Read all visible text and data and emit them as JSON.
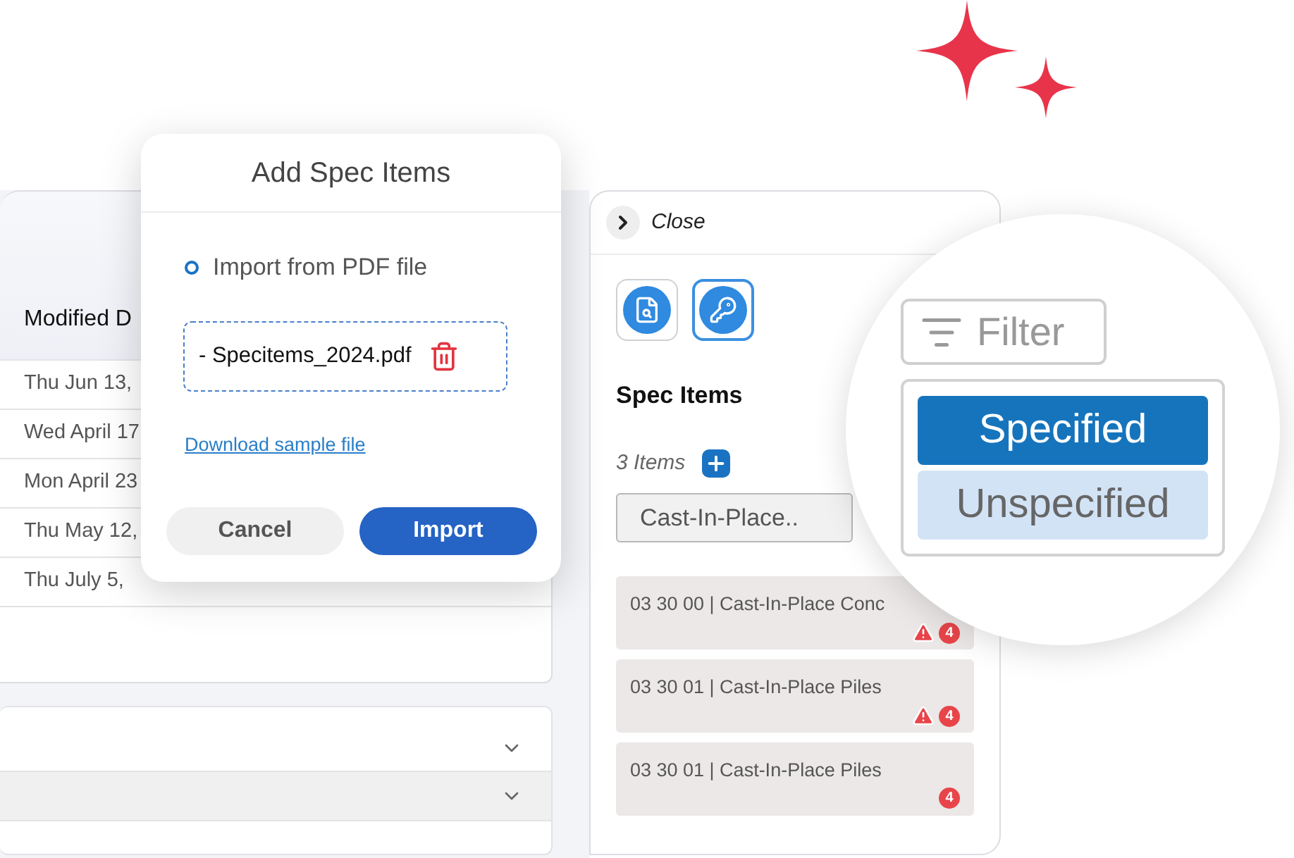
{
  "table": {
    "header": "Modified D",
    "rows": [
      "Thu Jun 13,",
      "Wed April 17",
      "Mon April 23",
      "Thu May 12,",
      "Thu July 5,"
    ]
  },
  "accordion": [
    {
      "expanded": false,
      "highlighted": false
    },
    {
      "expanded": false,
      "highlighted": true
    }
  ],
  "modal": {
    "title": "Add Spec Items",
    "option": {
      "label": "Import from PDF file",
      "selected": true
    },
    "file": "- Specitems_2024.pdf",
    "link": "Download sample file",
    "buttons": [
      {
        "label": "Cancel",
        "kind": "secondary"
      },
      {
        "label": "Import",
        "kind": "primary"
      }
    ]
  },
  "panel": {
    "close": "Close",
    "tools": [
      {
        "kind": "document",
        "selected": false
      },
      {
        "kind": "key",
        "selected": true
      }
    ],
    "title": "Spec Items",
    "count": "3 Items",
    "dropdown": "Cast-In-Place..",
    "items": [
      {
        "text": "03 30 00 | Cast-In-Place Conc",
        "warning": true,
        "badge": "4"
      },
      {
        "text": "03 30 01 | Cast-In-Place Piles",
        "warning": true,
        "badge": "4"
      },
      {
        "text": "03 30 01 | Cast-In-Place Piles",
        "warning": false,
        "badge": "4"
      }
    ]
  },
  "filter": {
    "label": "Filter",
    "options": [
      {
        "label": "Specified",
        "selected": true
      },
      {
        "label": "Unspecified",
        "selected": false
      }
    ]
  }
}
